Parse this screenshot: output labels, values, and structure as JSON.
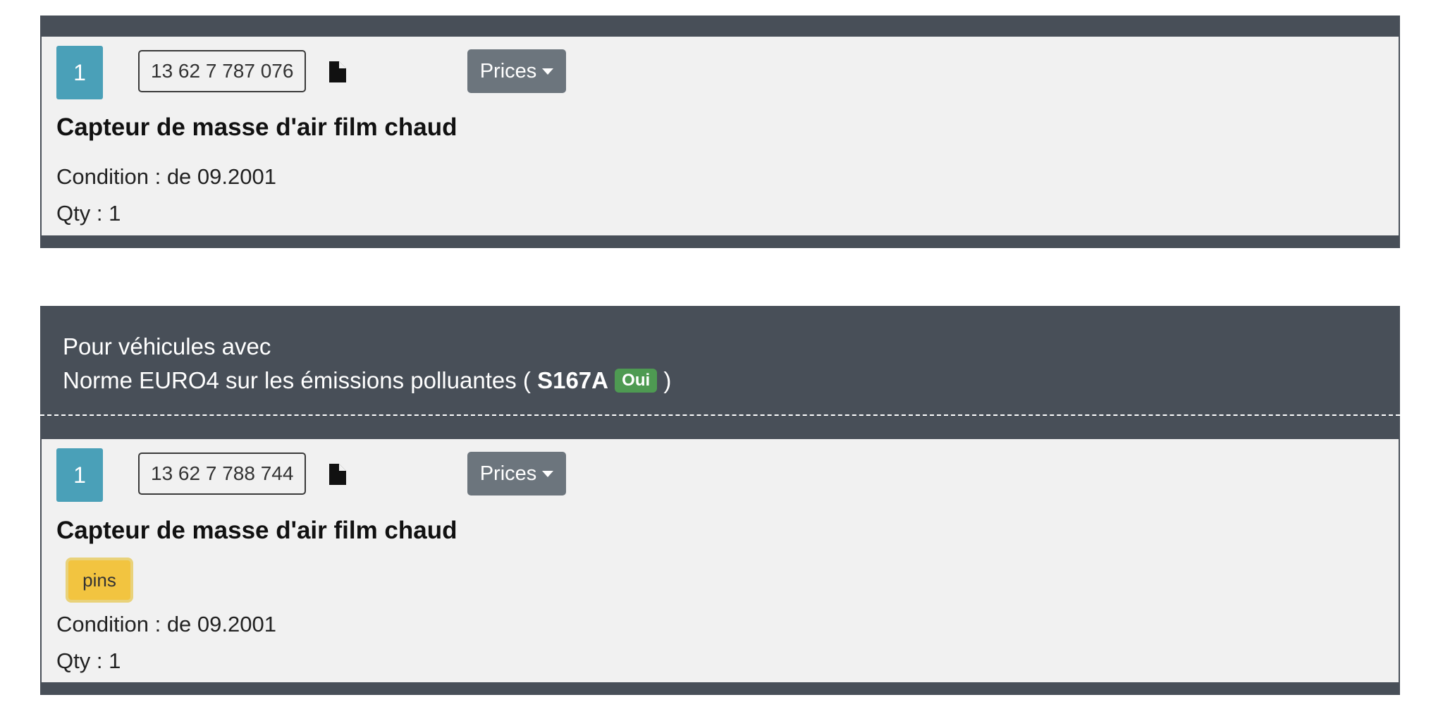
{
  "items": [
    {
      "index": "1",
      "part_number": "13 62 7 787 076",
      "doc_icon": "document-icon",
      "prices_label": "Prices",
      "title": "Capteur de masse d'air film chaud",
      "condition": "Condition : de 09.2001",
      "qty": "Qty : 1"
    },
    {
      "header_line1": "Pour véhicules avec",
      "header_line2_prefix": "Norme EURO4 sur les émissions polluantes (",
      "header_code": "S167A",
      "header_badge": "Oui",
      "header_line2_suffix": ")",
      "index": "1",
      "part_number": "13 62 7 788 744",
      "doc_icon": "document-icon",
      "prices_label": "Prices",
      "title": "Capteur de masse d'air film chaud",
      "tag": "pins",
      "condition": "Condition : de 09.2001",
      "qty": "Qty : 1"
    }
  ],
  "colors": {
    "card_frame": "#484f58",
    "card_body": "#f1f1f1",
    "index_box": "#4aa0b8",
    "prices_button": "#6c757d",
    "badge_oui": "#4e9a52",
    "tag_pins": "#f2c440"
  }
}
